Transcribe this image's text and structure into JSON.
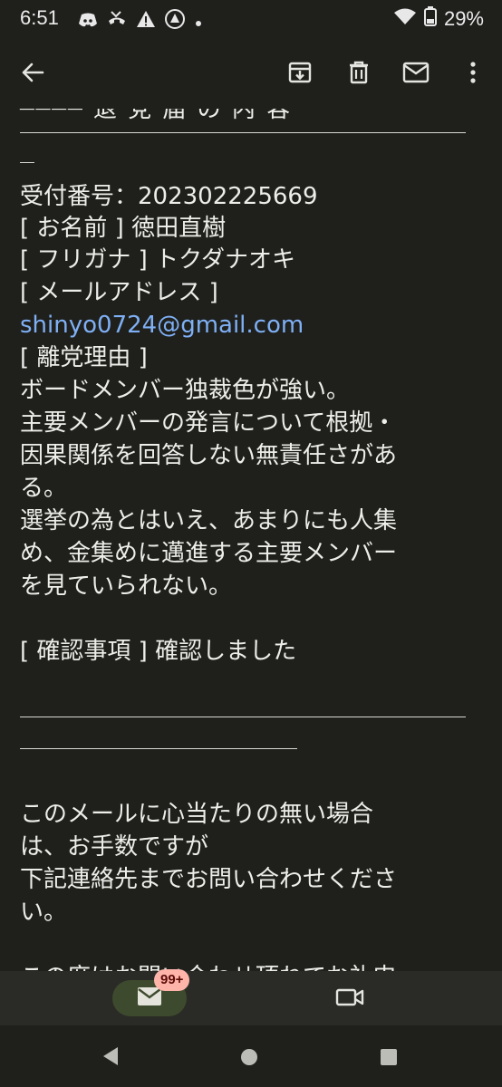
{
  "status": {
    "time": "6:51",
    "battery": "29%",
    "icons": [
      "discord-icon",
      "missed-call-icon",
      "warning-icon",
      "app-badge-icon",
      "dot-icon",
      "wifi-icon",
      "battery-icon"
    ]
  },
  "toolbar": {
    "icons": [
      "back-arrow-icon",
      "archive-icon",
      "delete-icon",
      "mark-unread-icon",
      "more-vert-icon"
    ]
  },
  "email": {
    "clipped_top": "──── 退 党 届 の 内 容",
    "lines": [
      "受付番号：202302225669",
      "[ お名前 ] 徳田直樹",
      "[ フリガナ ] トクダナオキ",
      "[ メールアドレス ]",
      "shinyo0724@gmail.com",
      "[ 離党理由 ]",
      "ボードメンバー独裁色が強い。",
      "主要メンバーの発言について根拠・",
      "因果関係を回答しない無責任さがあ",
      "る。",
      "選挙の為とはいえ、あまりにも人集",
      "め、金集めに邁進する主要メンバー",
      "を見ていられない。",
      "[ 確認事項 ] 確認しました",
      "このメールに心当たりの無い場合",
      "は、お手数ですが",
      "下記連絡先までお問い合わせくださ",
      "い。",
      "この度はお問い合わせ頂ねてお礼申"
    ]
  },
  "bottom_nav": {
    "mail_badge": "99+",
    "icons": [
      "mail-icon",
      "video-icon"
    ]
  },
  "system_nav": {
    "icons": [
      "back-triangle-icon",
      "home-circle-icon",
      "recents-square-icon"
    ]
  }
}
